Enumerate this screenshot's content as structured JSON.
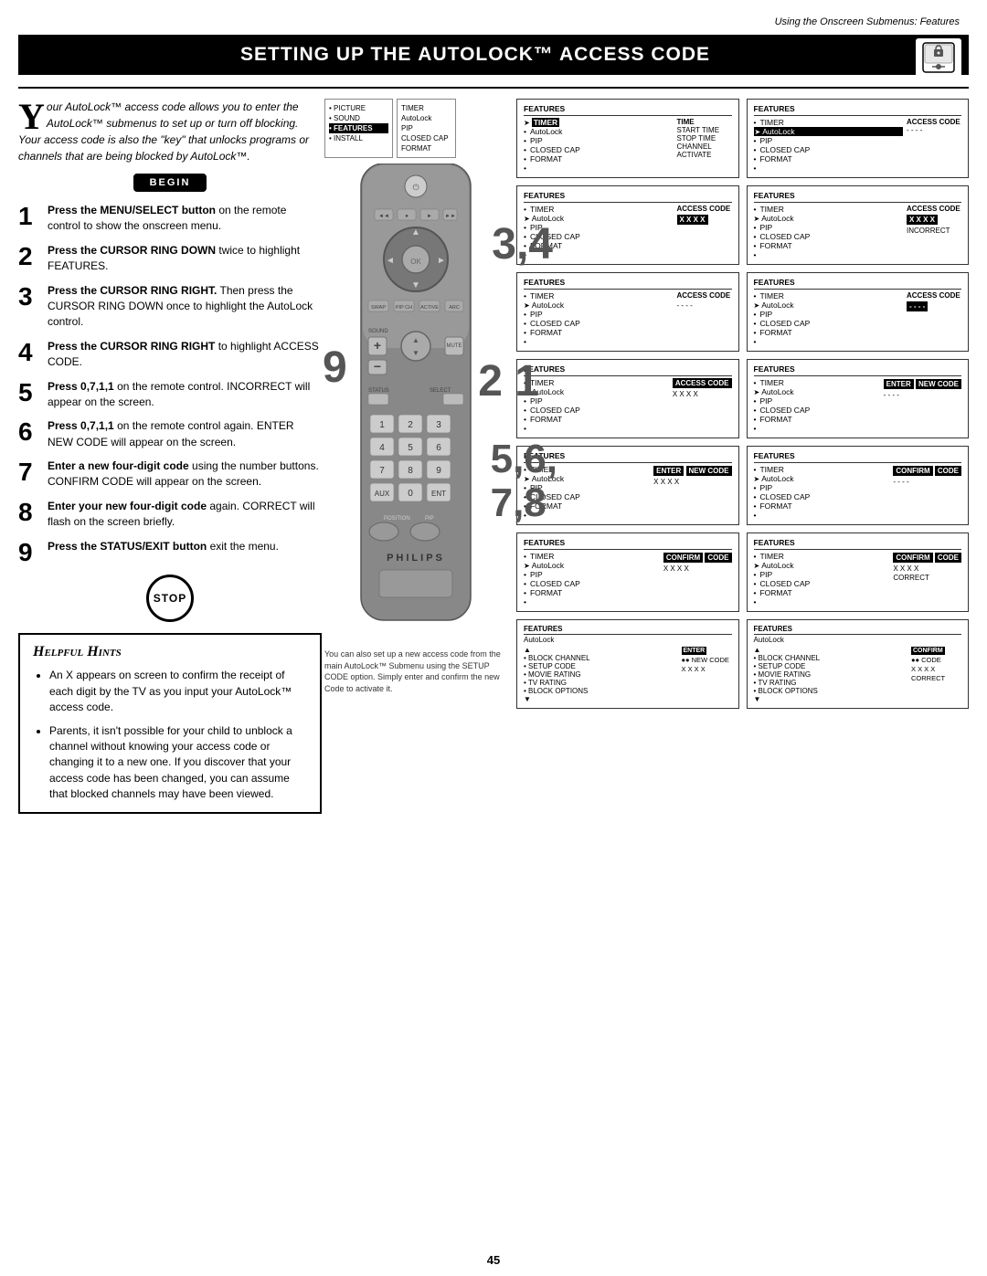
{
  "page": {
    "top_label": "Using the Onscreen Submenus: Features",
    "title": "Setting up the AutoLock™ Access Code",
    "page_number": "45"
  },
  "intro": {
    "drop_cap": "Y",
    "text": "our AutoLock™ access code allows you to enter the AutoLock™ submenus to set up or turn off blocking. Your access code is also the \"key\" that unlocks programs or channels that are being blocked by AutoLock™."
  },
  "begin_label": "BEGIN",
  "stop_label": "STOP",
  "steps": [
    {
      "num": "1",
      "bold": "Press the MENU/SELECT button",
      "rest": "on the remote control to show the onscreen menu."
    },
    {
      "num": "2",
      "bold": "Press the CURSOR RING DOWN",
      "rest": "twice to highlight FEATURES."
    },
    {
      "num": "3",
      "bold": "Press the CURSOR RING RIGHT.",
      "rest": "Then press the CURSOR RING DOWN once to highlight the AutoLock control."
    },
    {
      "num": "4",
      "bold": "Press the CURSOR RING RIGHT",
      "rest": "to highlight ACCESS CODE."
    },
    {
      "num": "5",
      "bold": "Press 0,7,1,1",
      "rest": "on the remote control. INCORRECT will appear on the screen."
    },
    {
      "num": "6",
      "bold": "Press 0,7,1,1",
      "rest": "on the remote control again. ENTER NEW CODE will appear on the screen."
    },
    {
      "num": "7",
      "bold": "Enter a new four-digit code",
      "rest": "using the number buttons. CONFIRM CODE will appear on the screen."
    },
    {
      "num": "8",
      "bold": "Enter your new four-digit code",
      "rest": "again. CORRECT will flash on the screen briefly."
    },
    {
      "num": "9",
      "bold": "Press the STATUS/EXIT button",
      "rest": "exit the menu."
    }
  ],
  "hints": {
    "title": "Helpful Hints",
    "items": [
      "An X appears on screen to confirm the receipt of each digit by the TV as you input your AutoLock™ access code.",
      "Parents, it isn't possible for your child to unblock a channel without knowing your access code or changing it to a new one. If you discover that your access code has been changed, you can assume that blocked channels may have been viewed."
    ]
  },
  "remote": {
    "philips_label": "PHILIPS",
    "big_nums_top": "3,4",
    "big_nums_bottom": "5,6,\n7,8",
    "big_num_left": "9",
    "big_num_right": "2",
    "big_num_far_right": "1"
  },
  "screens": [
    {
      "id": "s1",
      "title": "FEATURES",
      "items": [
        {
          "bullet": "➤",
          "label": "TIMER",
          "right_label": "TIME",
          "right_sub": ""
        },
        {
          "bullet": "•",
          "label": "AutoLock",
          "right_label": "START TIME",
          "right_sub": ""
        },
        {
          "bullet": "•",
          "label": "PIP",
          "right_label": "STOP TIME",
          "right_sub": ""
        },
        {
          "bullet": "•",
          "label": "CLOSED CAP",
          "right_label": "CHANNEL",
          "right_sub": ""
        },
        {
          "bullet": "•",
          "label": "FORMAT",
          "right_label": "ACTIVATE",
          "right_sub": ""
        },
        {
          "bullet": "•",
          "label": "",
          "right_label": "",
          "right_sub": ""
        }
      ],
      "highlighted": "TIMER"
    },
    {
      "id": "s2",
      "title": "FEATURES",
      "items": [
        {
          "bullet": "•",
          "label": "TIMER",
          "right_label": "ACCESS CODE",
          "right_sub": ""
        },
        {
          "bullet": "➤",
          "label": "AutoLock",
          "right_label": "- - - -",
          "right_sub": "",
          "sel": true
        },
        {
          "bullet": "•",
          "label": "PIP",
          "right_label": "",
          "right_sub": ""
        },
        {
          "bullet": "•",
          "label": "CLOSED CAP",
          "right_label": "",
          "right_sub": ""
        },
        {
          "bullet": "•",
          "label": "FORMAT",
          "right_label": "",
          "right_sub": ""
        },
        {
          "bullet": "•",
          "label": "",
          "right_label": "",
          "right_sub": ""
        }
      ]
    },
    {
      "id": "s3",
      "title": "FEATURES",
      "items": [
        {
          "bullet": "•",
          "label": "TIMER",
          "right_label": "ACCESS CODE",
          "right_sub": ""
        },
        {
          "bullet": "➤",
          "label": "AutoLock",
          "right_label": "- - - -",
          "right_sub": ""
        },
        {
          "bullet": "•",
          "label": "PIP",
          "right_label": "",
          "right_sub": ""
        },
        {
          "bullet": "•",
          "label": "CLOSED CAP",
          "right_label": "",
          "right_sub": ""
        },
        {
          "bullet": "•",
          "label": "FORMAT",
          "right_label": "",
          "right_sub": ""
        },
        {
          "bullet": "•",
          "label": "",
          "right_label": "",
          "right_sub": ""
        }
      ]
    },
    {
      "id": "s4",
      "title": "FEATURES",
      "items": [
        {
          "bullet": "•",
          "label": "TIMER",
          "right_label": "ACCESS CODE",
          "right_sub": "X X X X"
        },
        {
          "bullet": "➤",
          "label": "AutoLock",
          "right_label": "INCORRECT",
          "right_sub": ""
        },
        {
          "bullet": "•",
          "label": "PIP",
          "right_label": "",
          "right_sub": ""
        },
        {
          "bullet": "•",
          "label": "CLOSED CAP",
          "right_label": "",
          "right_sub": ""
        },
        {
          "bullet": "•",
          "label": "FORMAT",
          "right_label": "",
          "right_sub": ""
        },
        {
          "bullet": "•",
          "label": "",
          "right_label": "",
          "right_sub": ""
        }
      ]
    },
    {
      "id": "s5",
      "title": "FEATURES",
      "items": [
        {
          "bullet": "•",
          "label": "TIMER",
          "right_label": "ACCESS CODE",
          "right_sub": "- - - -"
        },
        {
          "bullet": "➤",
          "label": "AutoLock",
          "right_label": "",
          "right_sub": ""
        },
        {
          "bullet": "•",
          "label": "PIP",
          "right_label": "",
          "right_sub": ""
        },
        {
          "bullet": "•",
          "label": "CLOSED CAP",
          "right_label": "",
          "right_sub": ""
        },
        {
          "bullet": "•",
          "label": "FORMAT",
          "right_label": "",
          "right_sub": ""
        },
        {
          "bullet": "•",
          "label": "",
          "right_label": "",
          "right_sub": ""
        }
      ]
    },
    {
      "id": "s6",
      "title": "FEATURES",
      "items": [
        {
          "bullet": "•",
          "label": "TIMER",
          "right_label": "ACCESS CODE",
          "right_sub": "X X X X"
        },
        {
          "bullet": "➤",
          "label": "AutoLock",
          "right_label": "INCORRECT",
          "right_sub": ""
        },
        {
          "bullet": "•",
          "label": "PIP",
          "right_label": "",
          "right_sub": ""
        },
        {
          "bullet": "•",
          "label": "CLOSED CAP",
          "right_label": "",
          "right_sub": ""
        },
        {
          "bullet": "•",
          "label": "FORMAT",
          "right_label": "",
          "right_sub": ""
        },
        {
          "bullet": "•",
          "label": "",
          "right_label": "",
          "right_sub": ""
        }
      ]
    },
    {
      "id": "s7",
      "title": "FEATURES",
      "items": [
        {
          "bullet": "•",
          "label": "TIMER",
          "right_label": "ACCESS CODE",
          "right_sub": "X X X X"
        },
        {
          "bullet": "➤",
          "label": "AutoLock",
          "right_label": "",
          "right_sub": ""
        },
        {
          "bullet": "•",
          "label": "PIP",
          "right_label": "",
          "right_sub": ""
        },
        {
          "bullet": "•",
          "label": "CLOSED CAP",
          "right_label": "",
          "right_sub": ""
        },
        {
          "bullet": "•",
          "label": "FORMAT",
          "right_label": "",
          "right_sub": ""
        },
        {
          "bullet": "•",
          "label": "",
          "right_label": "",
          "right_sub": ""
        }
      ],
      "box_label": "ENTER",
      "box_sub": "NEW CODE"
    },
    {
      "id": "s8",
      "title": "FEATURES",
      "items": [
        {
          "bullet": "•",
          "label": "TIMER",
          "right_label": "ENTER",
          "right_sub": ""
        },
        {
          "bullet": "➤",
          "label": "AutoLock",
          "right_label": "NEW CODE",
          "right_sub": ""
        },
        {
          "bullet": "•",
          "label": "PIP",
          "right_label": "X X X X",
          "right_sub": ""
        },
        {
          "bullet": "•",
          "label": "CLOSED CAP",
          "right_label": "",
          "right_sub": ""
        },
        {
          "bullet": "•",
          "label": "FORMAT",
          "right_label": "",
          "right_sub": ""
        },
        {
          "bullet": "•",
          "label": "",
          "right_label": "",
          "right_sub": ""
        }
      ]
    },
    {
      "id": "s9",
      "title": "FEATURES",
      "items": [
        {
          "bullet": "•",
          "label": "TIMER",
          "right_label": "ENTER",
          "right_sub": ""
        },
        {
          "bullet": "➤",
          "label": "AutoLock",
          "right_label": "NEW CODE",
          "right_sub": ""
        },
        {
          "bullet": "•",
          "label": "PIP",
          "right_label": "X X X X",
          "right_sub": ""
        },
        {
          "bullet": "•",
          "label": "CLOSED CAP",
          "right_label": "",
          "right_sub": ""
        },
        {
          "bullet": "•",
          "label": "FORMAT",
          "right_label": "",
          "right_sub": ""
        },
        {
          "bullet": "•",
          "label": "",
          "right_label": "",
          "right_sub": ""
        }
      ]
    },
    {
      "id": "s10",
      "title": "FEATURES",
      "items": [
        {
          "bullet": "•",
          "label": "TIMER",
          "right_label": "CONFIRM",
          "right_sub": ""
        },
        {
          "bullet": "➤",
          "label": "AutoLock",
          "right_label": "CODE",
          "right_sub": ""
        },
        {
          "bullet": "•",
          "label": "PIP",
          "right_label": "- - - -",
          "right_sub": ""
        },
        {
          "bullet": "•",
          "label": "CLOSED CAP",
          "right_label": "",
          "right_sub": ""
        },
        {
          "bullet": "•",
          "label": "FORMAT",
          "right_label": "",
          "right_sub": ""
        },
        {
          "bullet": "•",
          "label": "",
          "right_label": "",
          "right_sub": ""
        }
      ]
    },
    {
      "id": "s11",
      "title": "FEATURES",
      "items": [
        {
          "bullet": "•",
          "label": "TIMER",
          "right_label": "CONFIRM",
          "right_sub": ""
        },
        {
          "bullet": "➤",
          "label": "AutoLock",
          "right_label": "CODE",
          "right_sub": ""
        },
        {
          "bullet": "•",
          "label": "PIP",
          "right_label": "X X X X",
          "right_sub": ""
        },
        {
          "bullet": "•",
          "label": "CLOSED CAP",
          "right_label": "",
          "right_sub": ""
        },
        {
          "bullet": "•",
          "label": "FORMAT",
          "right_label": "",
          "right_sub": ""
        },
        {
          "bullet": "•",
          "label": "",
          "right_label": "",
          "right_sub": ""
        }
      ]
    },
    {
      "id": "s12",
      "title": "FEATURES",
      "items": [
        {
          "bullet": "•",
          "label": "TIMER",
          "right_label": "CONFIRM",
          "right_sub": ""
        },
        {
          "bullet": "➤",
          "label": "AutoLock",
          "right_label": "CODE",
          "right_sub": ""
        },
        {
          "bullet": "•",
          "label": "PIP",
          "right_label": "X X X X",
          "right_sub": ""
        },
        {
          "bullet": "•",
          "label": "CLOSED CAP",
          "right_label": "CORRECT",
          "right_sub": ""
        },
        {
          "bullet": "•",
          "label": "FORMAT",
          "right_label": "",
          "right_sub": ""
        },
        {
          "bullet": "•",
          "label": "",
          "right_label": "",
          "right_sub": ""
        }
      ]
    }
  ],
  "menu_top_left": {
    "items": [
      "• PICTURE",
      "• SOUND",
      "• FEATURES",
      "• INSTALL"
    ],
    "right_items": [
      "TIMER",
      "AutoLock",
      "PIP",
      "CLOSED CAP",
      "FORMAT"
    ],
    "selected": "FEATURES"
  },
  "bottom_caption": "You can also set up a new access code from the main AutoLock™ Submenu using the SETUP CODE option. Simply enter and confirm the new Code to activate it.",
  "bottom_screens_left": {
    "title": "FEATURES",
    "sub": "AutoLock",
    "items": [
      "• BLOCK CHANNEL",
      "• SETUP CODE",
      "• MOVIE RATING",
      "• TV RATING",
      "• BLOCK OPTIONS"
    ],
    "code_label": "ENTER",
    "code_sub": "●● NEW CODE",
    "code_val": "X X X X"
  },
  "bottom_screens_right": {
    "title": "FEATURES",
    "sub": "AutoLock",
    "items": [
      "• BLOCK CHANNEL",
      "• SETUP CODE",
      "• MOVIE RATING",
      "• TV RATING",
      "• BLOCK OPTIONS"
    ],
    "code_label": "CONFIRM",
    "code_sub": "●● CODE",
    "code_val": "X X X X",
    "correct": "CORRECT"
  }
}
